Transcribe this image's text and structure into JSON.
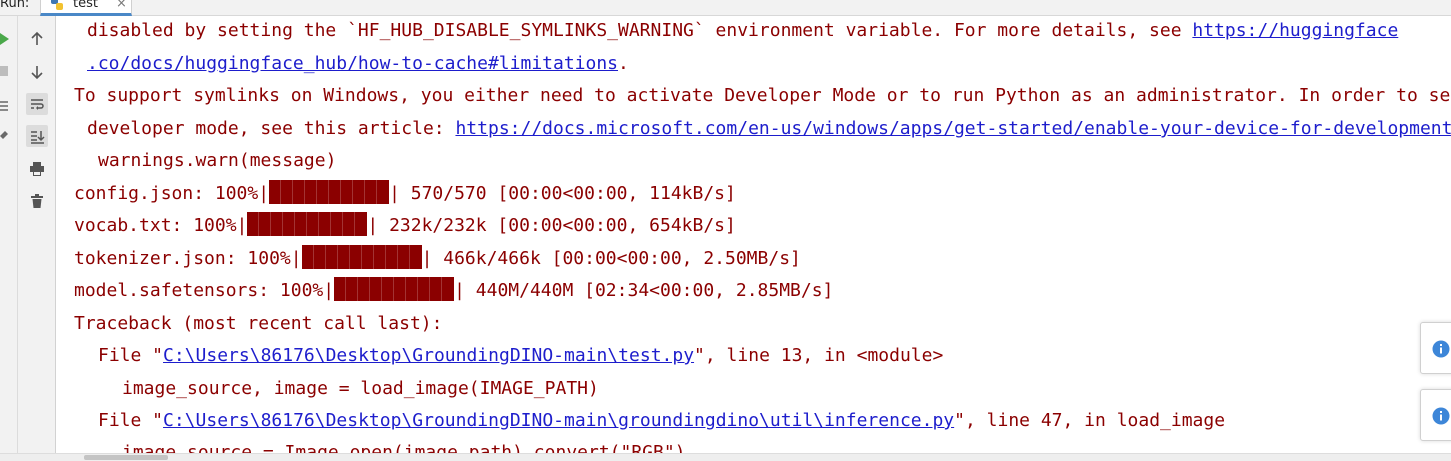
{
  "header": {
    "run_label": "Run:",
    "tab_label": "test",
    "tab_close": "×"
  },
  "toolbar": {
    "icons": [
      "up-arrow-icon",
      "down-arrow-icon",
      "soft-wrap-icon",
      "scroll-to-end-icon",
      "print-icon",
      "trash-icon"
    ]
  },
  "console": {
    "line1_text": "disabled by setting the `HF_HUB_DISABLE_SYMLINKS_WARNING` environment variable. For more details, see ",
    "line1_link": "https://huggingface",
    "line2_link": ".co/docs/huggingface_hub/how-to-cache#limitations",
    "line2_text": ".",
    "line3_text": "To support symlinks on Windows, you either need to activate Developer Mode or to run Python as an administrator. In order to see activate",
    "line4_text": "developer mode, see this article: ",
    "line4_link": "https://docs.microsoft.com/en-us/windows/apps/get-started/enable-your-device-for-development",
    "line5_text": "warnings.warn(message)",
    "downloads": [
      {
        "label": "config.json: 100%|",
        "stats": "| 570/570 [00:00<00:00, 114kB/s]",
        "progress": 1.0
      },
      {
        "label": "vocab.txt: 100%|",
        "stats": "| 232k/232k [00:00<00:00, 654kB/s]",
        "progress": 1.0
      },
      {
        "label": "tokenizer.json: 100%|",
        "stats": "| 466k/466k [00:00<00:00, 2.50MB/s]",
        "progress": 1.0
      },
      {
        "label": "model.safetensors: 100%|",
        "stats": "| 440M/440M [02:34<00:00, 2.85MB/s]",
        "progress": 1.0
      }
    ],
    "traceback_header": "Traceback (most recent call last):",
    "frame1_prefix": "File \"",
    "frame1_link": "C:\\Users\\86176\\Desktop\\GroundingDINO-main\\test.py",
    "frame1_suffix": "\", line 13, in <module>",
    "frame1_code": "image_source, image = load_image(IMAGE_PATH)",
    "frame2_prefix": "File \"",
    "frame2_link": "C:\\Users\\86176\\Desktop\\GroundingDINO-main\\groundingdino\\util\\inference.py",
    "frame2_suffix": "\", line 47, in load_image",
    "frame2_code": "image_source = Image.open(image_path).convert(\"RGB\")"
  },
  "colors": {
    "console_text": "#8b0000",
    "link": "#1d1dcc",
    "progress_bar": "#8b0000",
    "tab_underline": "#4a88c7",
    "info_icon": "#3d86d8"
  }
}
